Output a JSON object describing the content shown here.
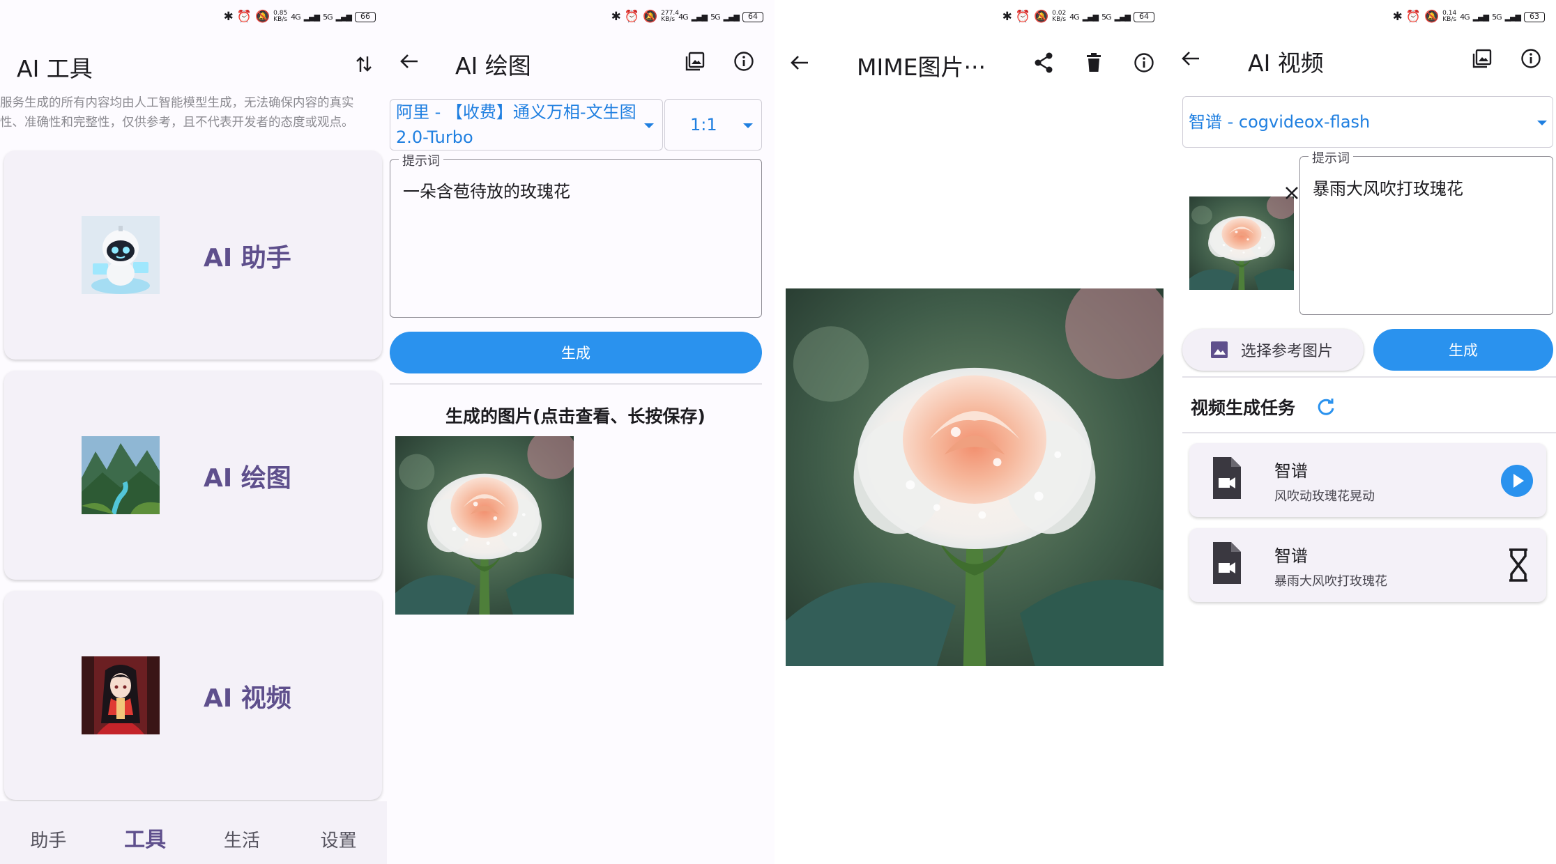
{
  "status_bar": {
    "panel1": {
      "net_speed": "0.85 KB/s",
      "net1": "4G",
      "net2": "5G",
      "battery": "66"
    },
    "panel2": {
      "net_speed": "277.4 KB/s",
      "net1": "4G",
      "net2": "5G",
      "battery": "64"
    },
    "panel3": {
      "net_speed": "0.02 KB/s",
      "net1": "4G",
      "net2": "5G",
      "battery": "64"
    },
    "panel4": {
      "net_speed": "0.14 KB/s",
      "net1": "4G",
      "net2": "5G",
      "battery": "63"
    }
  },
  "tools_screen": {
    "title": "AI 工具",
    "disclaimer_line1": "服务生成的所有内容均由人工智能模型生成，无法确保内容的真实",
    "disclaimer_line2": "性、准确性和完整性，仅供参考，且不代表开发者的态度或观点。",
    "cards": [
      {
        "label": "AI 助手",
        "thumb_icon": "robot-thumbnail"
      },
      {
        "label": "AI 绘图",
        "thumb_icon": "landscape-thumbnail"
      },
      {
        "label": "AI 视频",
        "thumb_icon": "anime-girl-thumbnail"
      }
    ],
    "nav": [
      {
        "label": "助手",
        "active": false
      },
      {
        "label": "工具",
        "active": true
      },
      {
        "label": "生活",
        "active": false
      },
      {
        "label": "设置",
        "active": false
      }
    ]
  },
  "drawing_screen": {
    "title": "AI 绘图",
    "model_line1": "阿里 - 【收费】通义万相-文生图",
    "model_line2": "2.0-Turbo",
    "ratio": "1:1",
    "prompt_label": "提示词",
    "prompt_value": "一朵含苞待放的玫瑰花",
    "generate_label": "生成",
    "results_title": "生成的图片(点击查看、长按保存)"
  },
  "viewer_screen": {
    "title": "MIME图片···"
  },
  "video_screen": {
    "title": "AI 视频",
    "model": "智谱 - cogvideox-flash",
    "prompt_label": "提示词",
    "prompt_value": "暴雨大风吹打玫瑰花",
    "choose_ref_label": "选择参考图片",
    "generate_label": "生成",
    "tasks_title": "视频生成任务",
    "tasks": [
      {
        "title": "智谱",
        "subtitle": "风吹动玫瑰花晃动",
        "status_icon": "play-icon"
      },
      {
        "title": "智谱",
        "subtitle": "暴雨大风吹打玫瑰花",
        "status_icon": "hourglass-icon"
      }
    ]
  },
  "colors": {
    "accent_blue": "#2a92ee",
    "link_blue": "#1f7fe0",
    "primary_purple": "#5e4f8c",
    "card_bg": "#f4f1f8"
  }
}
